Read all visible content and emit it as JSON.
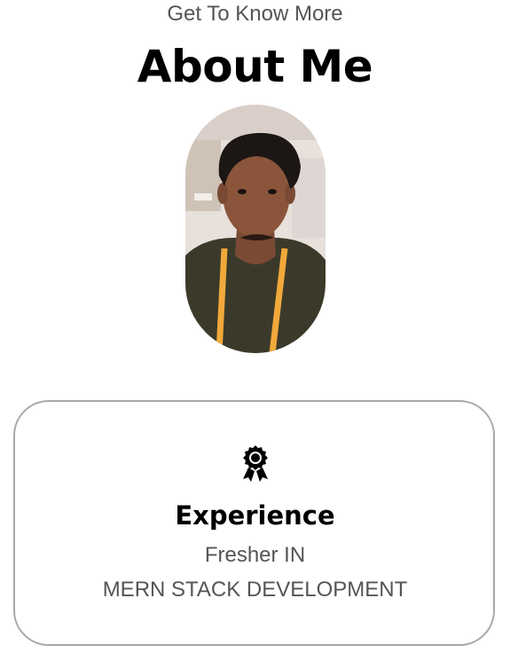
{
  "section": {
    "subtitle": "Get To Know More",
    "title": "About Me"
  },
  "profile": {
    "photo_alt": "Profile photo"
  },
  "experience_card": {
    "icon": "award-icon",
    "title": "Experience",
    "line1": "Fresher IN",
    "line2": "MERN STACK DEVELOPMENT"
  },
  "colors": {
    "text_muted": "#555555",
    "card_border": "#a8a8a8",
    "lanyard": "#f2a93b",
    "shirt": "#3b3a2a"
  }
}
